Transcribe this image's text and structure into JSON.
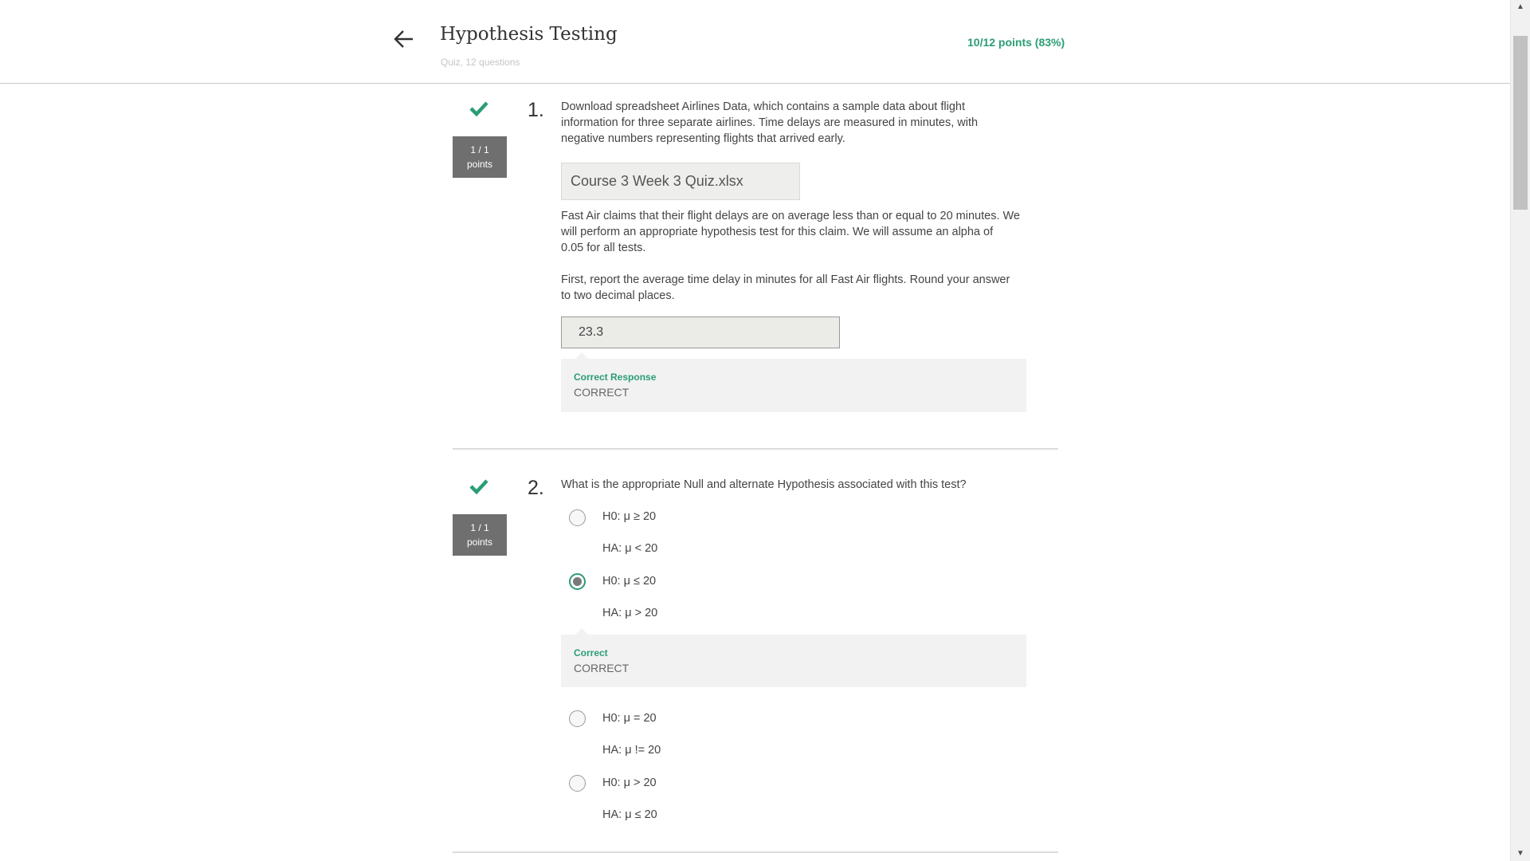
{
  "header": {
    "title": "Hypothesis Testing",
    "subtitle": "Quiz, 12 questions",
    "score": "10/12 points (83%)"
  },
  "colors": {
    "accent_green": "#2a9d73",
    "badge_gray": "#6f6f6f",
    "feedback_bg": "#f2f2f2"
  },
  "questions": [
    {
      "number": "1.",
      "points_line1": "1 / 1",
      "points_line2": "points",
      "status_icon": "check-icon",
      "prompt_lines": [
        "Download spreadsheet Airlines Data, which contains a sample data about flight",
        "information for three separate airlines. Time delays are measured in minutes, with",
        "negative numbers representing flights that arrived early."
      ],
      "file_name": "Course 3 Week 3 Quiz.xlsx",
      "para2_lines": [
        "Fast Air claims that their flight delays are on average less than or equal to 20 minutes. We",
        "will perform an appropriate hypothesis test for this claim. We will assume an alpha of",
        "0.05 for all tests."
      ],
      "para3_lines": [
        "First, report the average time delay in minutes for all Fast Air flights. Round your answer",
        "to two decimal places."
      ],
      "answer_value": "23.3",
      "feedback_label": "Correct Response",
      "feedback_text": "CORRECT"
    },
    {
      "number": "2.",
      "points_line1": "1 / 1",
      "points_line2": "points",
      "status_icon": "check-icon",
      "prompt": "What is the appropriate Null and alternate Hypothesis associated with this test?",
      "options": [
        {
          "h0": "H0: μ ≥ 20",
          "ha": "HA: μ < 20",
          "selected": false
        },
        {
          "h0": "H0: μ ≤ 20",
          "ha": "HA: μ > 20",
          "selected": true
        },
        {
          "h0": "H0: μ = 20",
          "ha": "HA: μ != 20",
          "selected": false
        },
        {
          "h0": "H0: μ > 20",
          "ha": "HA: μ ≤ 20",
          "selected": false
        }
      ],
      "feedback_label": "Correct",
      "feedback_text": "CORRECT"
    }
  ]
}
